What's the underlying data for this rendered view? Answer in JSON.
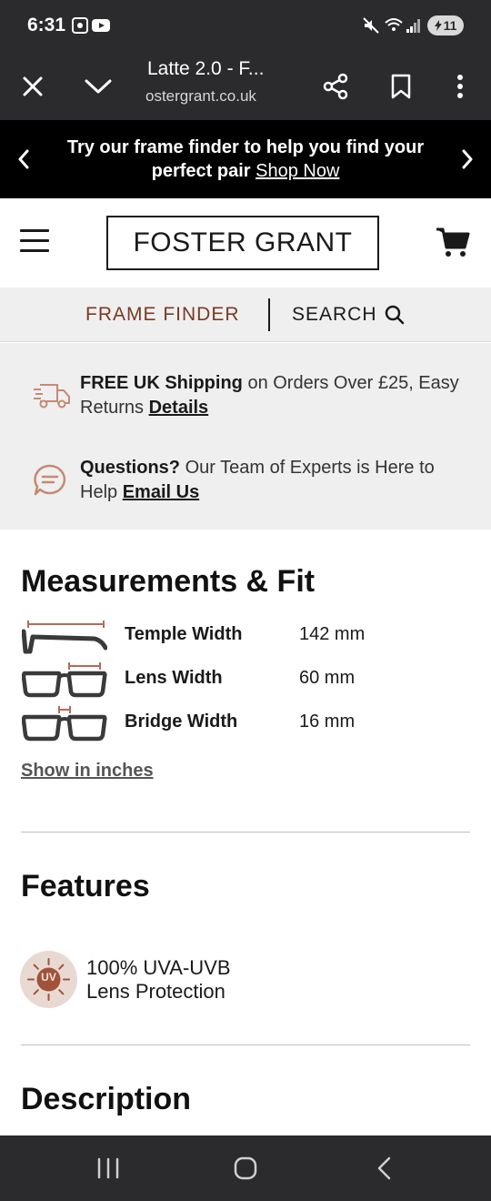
{
  "status_bar": {
    "time": "6:31",
    "battery": "11"
  },
  "browser": {
    "tab_title": "Latte 2.0 - F...",
    "url": "ostergrant.co.uk"
  },
  "promo": {
    "text": "Try our frame finder to help you find your perfect pair",
    "link": "Shop Now"
  },
  "header": {
    "logo": "FOSTER GRANT"
  },
  "nav": {
    "frame_finder": "FRAME FINDER",
    "search": "SEARCH"
  },
  "info": {
    "shipping_bold": "FREE UK Shipping",
    "shipping_text": " on Orders Over £25, Easy Returns ",
    "shipping_link": "Details",
    "questions_bold": "Questions?",
    "questions_text": " Our Team of Experts is Here to Help ",
    "questions_link": "Email Us"
  },
  "measurements": {
    "title": "Measurements & Fit",
    "rows": [
      {
        "label": "Temple Width",
        "value": "142 mm",
        "icon": "temple-width-icon"
      },
      {
        "label": "Lens Width",
        "value": "60 mm",
        "icon": "lens-width-icon"
      },
      {
        "label": "Bridge Width",
        "value": "16 mm",
        "icon": "bridge-width-icon"
      }
    ],
    "toggle_link": "Show in inches"
  },
  "features": {
    "title": "Features",
    "badge": "UV",
    "items": [
      {
        "line1": "100% UVA-UVB",
        "line2": "Lens Protection"
      }
    ]
  },
  "description": {
    "title": "Description"
  },
  "colors": {
    "accent_brown": "#7a3a23",
    "dark_bar": "#2b2b2d",
    "panel_gray": "#efefef"
  }
}
